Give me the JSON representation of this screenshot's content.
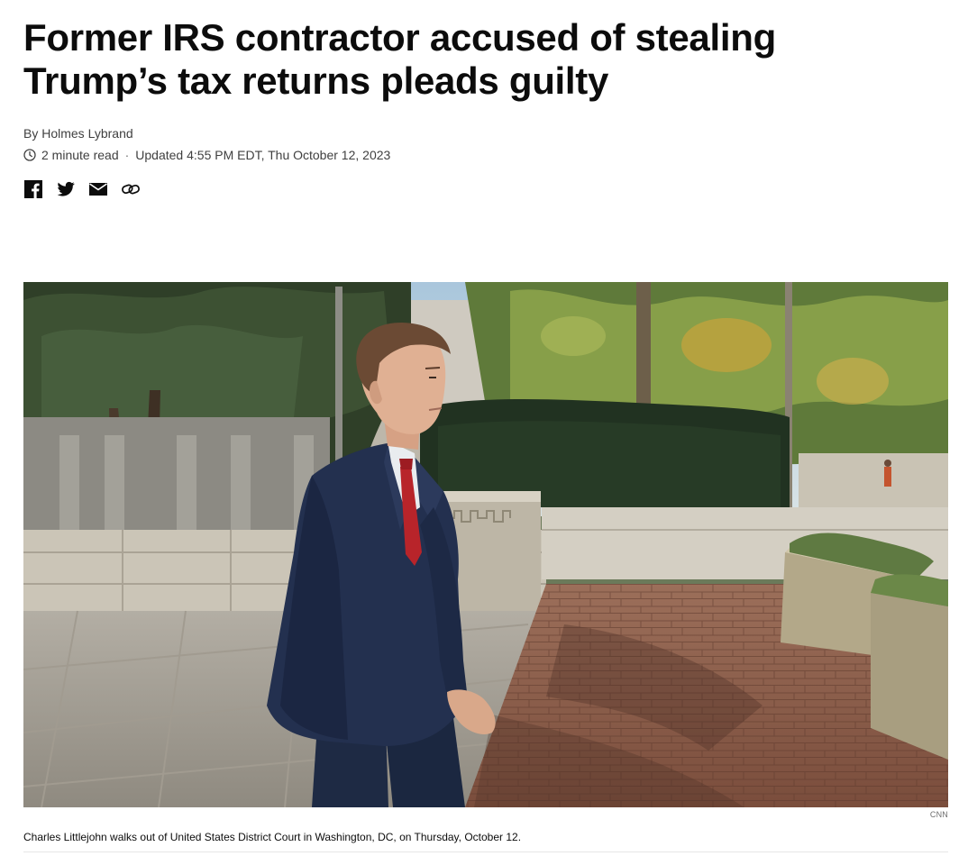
{
  "article": {
    "headline": "Former IRS contractor accused of stealing Trump’s tax returns pleads guilty",
    "byline": "By Holmes Lybrand",
    "read_time": "2 minute read",
    "separator": "·",
    "updated": "Updated 4:55 PM EDT, Thu October 12, 2023"
  },
  "share": {
    "icons": [
      "facebook-icon",
      "twitter-icon",
      "email-icon",
      "link-icon"
    ]
  },
  "image": {
    "credit": "CNN",
    "caption": "Charles Littlejohn walks out of United States District Court in Washington, DC, on Thursday, October 12."
  },
  "colors": {
    "text": "#0c0c0c",
    "meta": "#404040",
    "rule": "#e6e6e6"
  }
}
